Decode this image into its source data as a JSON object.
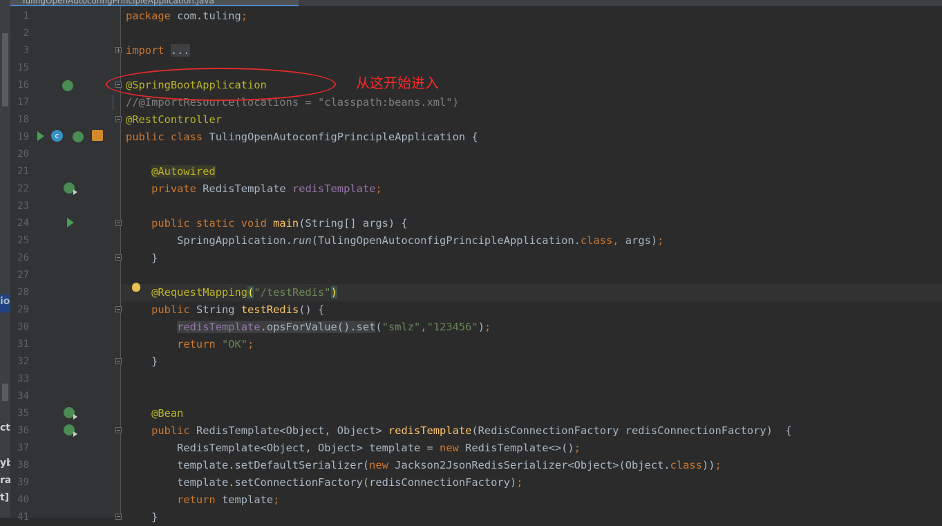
{
  "tab": {
    "title": "TulingOpenAutoconfigPrincipleApplication.java"
  },
  "annotation": {
    "text": "从这开始进入",
    "color": "#ff2a2a"
  },
  "colors": {
    "keyword": "#cc7832",
    "annotation": "#bbb529",
    "string": "#6a8759",
    "field": "#9876aa",
    "method": "#ffc66d",
    "default": "#a9b7c6",
    "background": "#2b2b2b"
  },
  "left_peek": [
    "io",
    "ct",
    "yb",
    "ral",
    "t]"
  ],
  "lines": [
    {
      "n": "1",
      "t": [
        {
          "c": "kw",
          "v": "package "
        },
        {
          "c": "",
          "v": "com.tuling"
        },
        {
          "c": "kw",
          "v": ";"
        }
      ]
    },
    {
      "n": "2",
      "t": []
    },
    {
      "n": "3",
      "t": [
        {
          "c": "kw",
          "v": "import "
        },
        {
          "c": "unused",
          "v": "..."
        }
      ]
    },
    {
      "n": "15",
      "t": []
    },
    {
      "n": "16",
      "t": [
        {
          "c": "ann",
          "v": "@SpringBootApplication"
        }
      ]
    },
    {
      "n": "17",
      "t": [
        {
          "c": "cm",
          "v": "//@ImportResource(locations = \"classpath:beans.xml\")"
        }
      ]
    },
    {
      "n": "18",
      "t": [
        {
          "c": "ann",
          "v": "@RestController"
        }
      ]
    },
    {
      "n": "19",
      "t": [
        {
          "c": "kw",
          "v": "public class "
        },
        {
          "c": "",
          "v": "TulingOpenAutoconfigPrincipleApplication {"
        }
      ]
    },
    {
      "n": "20",
      "t": []
    },
    {
      "n": "21",
      "t": [
        {
          "c": "",
          "v": "    "
        },
        {
          "c": "ann hl-ann",
          "v": "@Autowired"
        }
      ]
    },
    {
      "n": "22",
      "t": [
        {
          "c": "kw",
          "v": "    private "
        },
        {
          "c": "",
          "v": "RedisTemplate "
        },
        {
          "c": "fld",
          "v": "redisTemplate"
        },
        {
          "c": "kw",
          "v": ";"
        }
      ]
    },
    {
      "n": "23",
      "t": []
    },
    {
      "n": "24",
      "t": [
        {
          "c": "kw",
          "v": "    public static void "
        },
        {
          "c": "fn",
          "v": "main"
        },
        {
          "c": "",
          "v": "(String[] args) {"
        }
      ]
    },
    {
      "n": "25",
      "t": [
        {
          "c": "",
          "v": "        SpringApplication."
        },
        {
          "c": "it",
          "v": "run"
        },
        {
          "c": "",
          "v": "(TulingOpenAutoconfigPrincipleApplication."
        },
        {
          "c": "kw",
          "v": "class, "
        },
        {
          "c": "",
          "v": "args)"
        },
        {
          "c": "kw",
          "v": ";"
        }
      ]
    },
    {
      "n": "26",
      "t": [
        {
          "c": "",
          "v": "    }"
        }
      ]
    },
    {
      "n": "27",
      "t": []
    },
    {
      "n": "28",
      "t": [
        {
          "c": "",
          "v": "    "
        },
        {
          "c": "ann",
          "v": "@RequestMapping"
        },
        {
          "c": "paren-hl",
          "v": "("
        },
        {
          "c": "str",
          "v": "\"/testRedis\""
        },
        {
          "c": "paren-hl",
          "v": ")"
        }
      ]
    },
    {
      "n": "29",
      "t": [
        {
          "c": "kw",
          "v": "    public "
        },
        {
          "c": "",
          "v": "String "
        },
        {
          "c": "fn",
          "v": "testRedis"
        },
        {
          "c": "",
          "v": "() {"
        }
      ]
    },
    {
      "n": "30",
      "t": [
        {
          "c": "",
          "v": "        "
        },
        {
          "c": "fld unused",
          "v": "redisTemplate"
        },
        {
          "c": "unused",
          "v": ".opsForValue().set"
        },
        {
          "c": "",
          "v": "("
        },
        {
          "c": "str",
          "v": "\"smlz\""
        },
        {
          "c": "kw",
          "v": ","
        },
        {
          "c": "str",
          "v": "\"123456\""
        },
        {
          "c": "",
          "v": ")"
        },
        {
          "c": "kw",
          "v": ";"
        }
      ]
    },
    {
      "n": "31",
      "t": [
        {
          "c": "kw",
          "v": "        return "
        },
        {
          "c": "str",
          "v": "\"OK\""
        },
        {
          "c": "kw",
          "v": ";"
        }
      ]
    },
    {
      "n": "32",
      "t": [
        {
          "c": "",
          "v": "    }"
        }
      ]
    },
    {
      "n": "33",
      "t": []
    },
    {
      "n": "34",
      "t": []
    },
    {
      "n": "35",
      "t": [
        {
          "c": "",
          "v": "    "
        },
        {
          "c": "ann",
          "v": "@Bean"
        }
      ]
    },
    {
      "n": "36",
      "t": [
        {
          "c": "kw",
          "v": "    public "
        },
        {
          "c": "",
          "v": "RedisTemplate<Object, Object> "
        },
        {
          "c": "fn",
          "v": "redisTemplate"
        },
        {
          "c": "",
          "v": "(RedisConnectionFactory redisConnectionFactory)  {"
        }
      ]
    },
    {
      "n": "37",
      "t": [
        {
          "c": "",
          "v": "        RedisTemplate<Object, Object> template = "
        },
        {
          "c": "kw",
          "v": "new "
        },
        {
          "c": "",
          "v": "RedisTemplate<>()"
        },
        {
          "c": "kw",
          "v": ";"
        }
      ]
    },
    {
      "n": "38",
      "t": [
        {
          "c": "",
          "v": "        template.setDefaultSerializer("
        },
        {
          "c": "kw",
          "v": "new "
        },
        {
          "c": "",
          "v": "Jackson2JsonRedisSerializer<Object>(Object."
        },
        {
          "c": "kw",
          "v": "class"
        },
        {
          "c": "",
          "v": "))"
        },
        {
          "c": "kw",
          "v": ";"
        }
      ]
    },
    {
      "n": "39",
      "t": [
        {
          "c": "",
          "v": "        template.setConnectionFactory(redisConnectionFactory)"
        },
        {
          "c": "kw",
          "v": ";"
        }
      ]
    },
    {
      "n": "40",
      "t": [
        {
          "c": "kw",
          "v": "        return "
        },
        {
          "c": "",
          "v": "template"
        },
        {
          "c": "kw",
          "v": ";"
        }
      ]
    },
    {
      "n": "41",
      "t": [
        {
          "c": "",
          "v": "    }"
        }
      ]
    }
  ]
}
